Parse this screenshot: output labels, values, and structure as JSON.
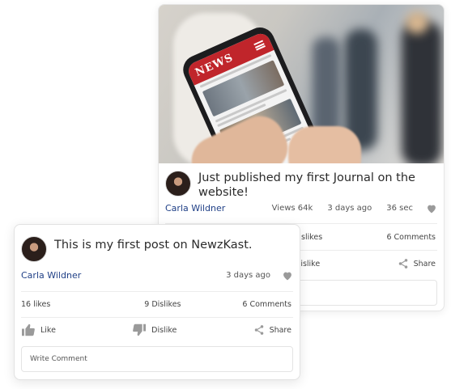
{
  "back_post": {
    "image": {
      "banner_text": "NEWS"
    },
    "title": "Just published my first Journal on the website!",
    "author": "Carla Wildner",
    "views": "Views 64k",
    "date": "3 days ago",
    "duration": "36 sec",
    "stats": {
      "dislikes": "slikes",
      "comments": "6 Comments"
    },
    "actions": {
      "dislike": "Dislike",
      "share": "Share"
    }
  },
  "front_post": {
    "title": "This is my first post on NewzKast.",
    "author": "Carla Wildner",
    "date": "3 days ago",
    "stats": {
      "likes": "16 likes",
      "dislikes": "9 Dislikes",
      "comments": "6 Comments"
    },
    "actions": {
      "like": "Like",
      "dislike": "Dislike",
      "share": "Share"
    },
    "comment_placeholder": "Write Comment"
  },
  "colors": {
    "author": "#1f3f86",
    "news_banner": "#c0252b",
    "icon_gray": "#9a9a9a"
  }
}
